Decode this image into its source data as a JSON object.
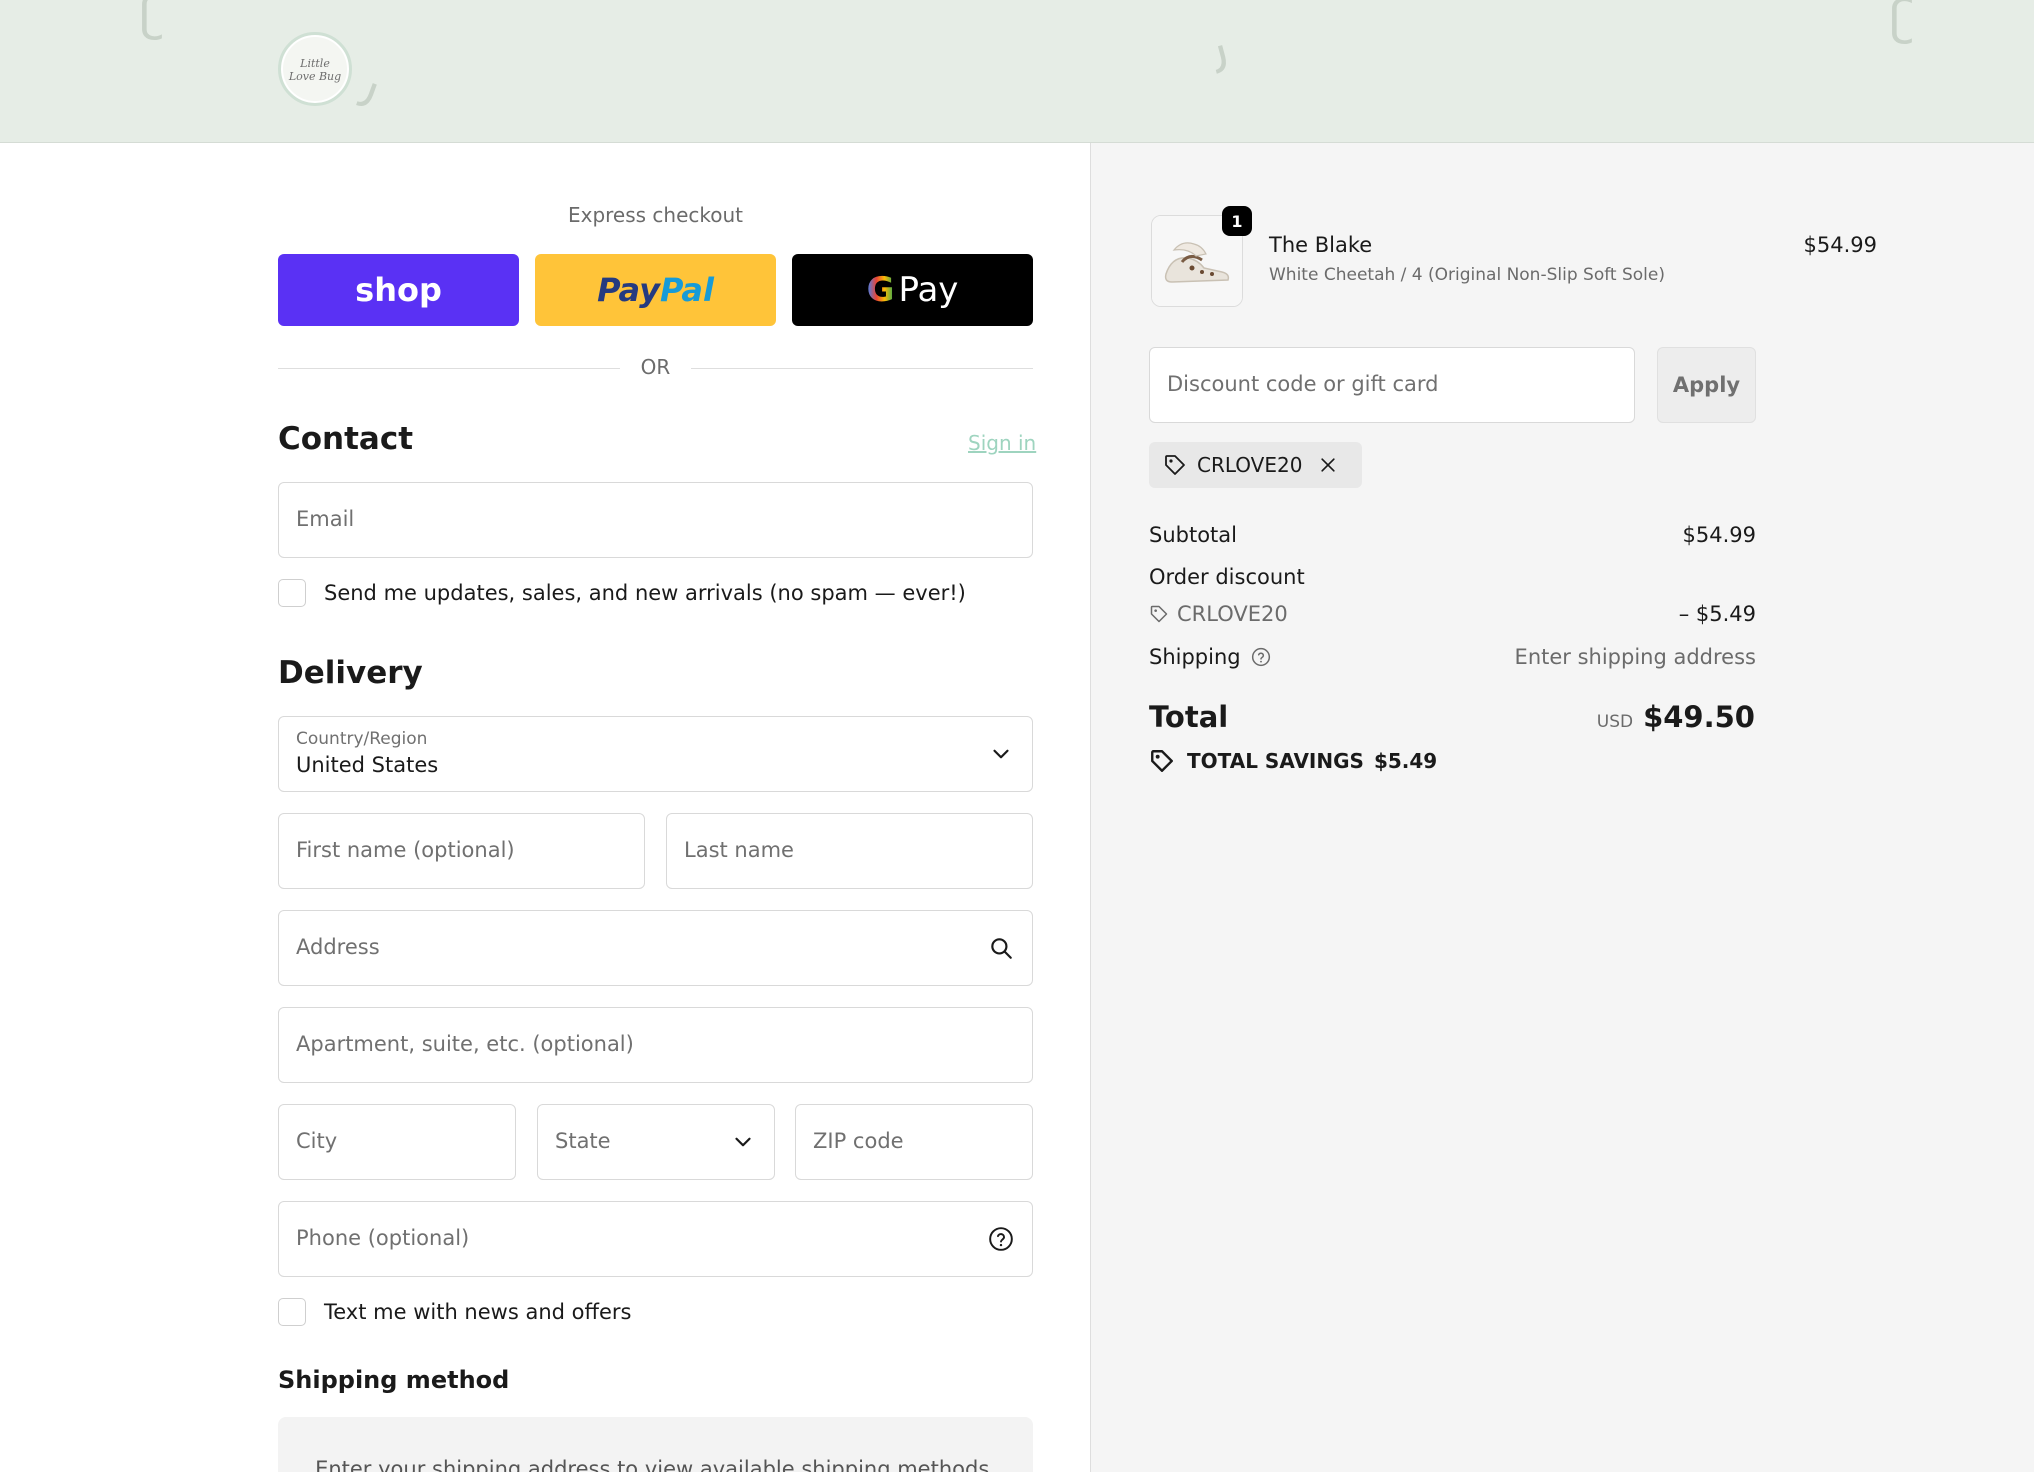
{
  "header": {
    "logo_text": "Little\nLove Bug"
  },
  "express": {
    "label": "Express checkout",
    "shop_label": "shop",
    "paypal_part1": "Pay",
    "paypal_part2": "Pal",
    "gpay_g": "G",
    "gpay_label": "Pay",
    "or_label": "OR"
  },
  "contact": {
    "title": "Contact",
    "sign_in": "Sign in",
    "email_placeholder": "Email",
    "updates_label": "Send me updates, sales, and new arrivals (no spam — ever!)"
  },
  "delivery": {
    "title": "Delivery",
    "country_label": "Country/Region",
    "country_value": "United States",
    "first_name_placeholder": "First name (optional)",
    "last_name_placeholder": "Last name",
    "address_placeholder": "Address",
    "apartment_placeholder": "Apartment, suite, etc. (optional)",
    "city_placeholder": "City",
    "state_placeholder": "State",
    "zip_placeholder": "ZIP code",
    "phone_placeholder": "Phone (optional)",
    "text_offers_label": "Text me with news and offers"
  },
  "shipping_method": {
    "title": "Shipping method",
    "message": "Enter your shipping address to view available shipping methods."
  },
  "order": {
    "item": {
      "quantity": "1",
      "name": "The Blake",
      "variant": "White Cheetah / 4 (Original Non-Slip Soft Sole)",
      "price": "$54.99"
    },
    "discount_placeholder": "Discount code or gift card",
    "apply_label": "Apply",
    "applied_code": "CRLOVE20",
    "subtotal_label": "Subtotal",
    "subtotal_value": "$54.99",
    "order_discount_label": "Order discount",
    "discount_code": "CRLOVE20",
    "discount_value": "– $5.49",
    "shipping_label": "Shipping",
    "shipping_value": "Enter shipping address",
    "total_label": "Total",
    "currency": "USD",
    "total_value": "$49.50",
    "savings_label": "TOTAL SAVINGS",
    "savings_value": "$5.49"
  },
  "colors": {
    "shop_purple": "#5a31f4",
    "paypal_yellow": "#ffc439",
    "gpay_black": "#000000",
    "header_green": "#e6ede6",
    "sign_in_link": "#9ed4bf"
  }
}
